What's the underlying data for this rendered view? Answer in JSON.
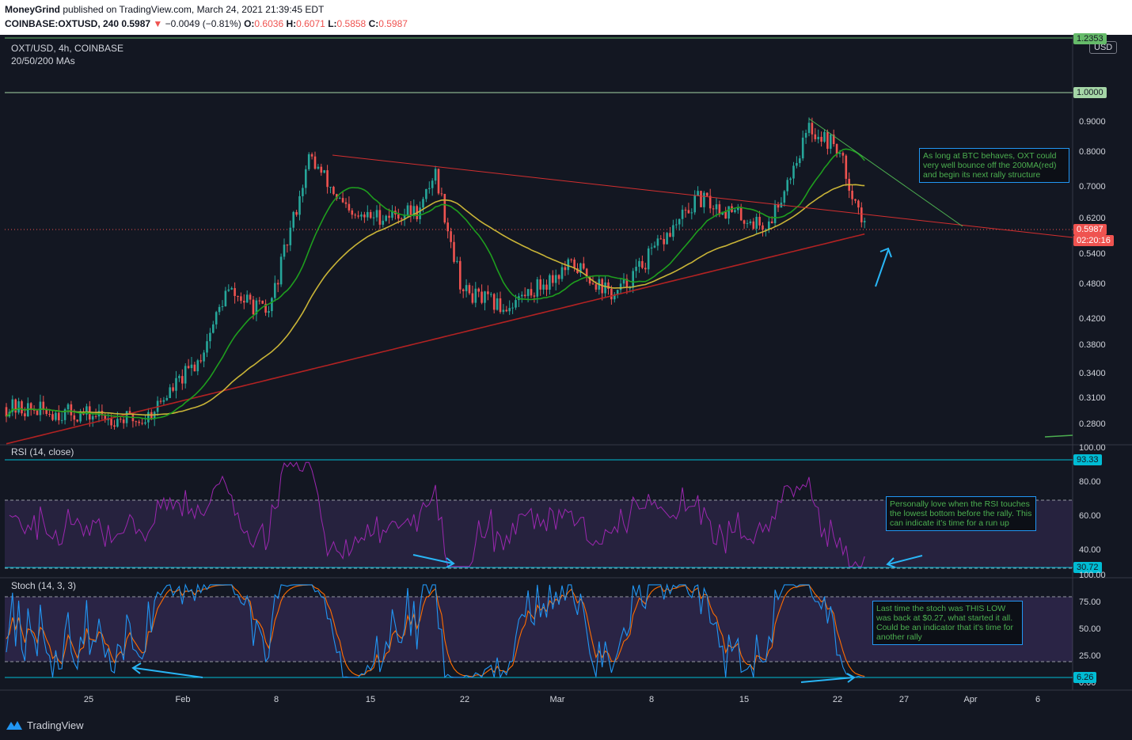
{
  "header": {
    "author": "MoneyGrind",
    "published": "published on TradingView.com, March 24, 2021 21:39:45 EDT",
    "symbol": "COINBASE:OXTUSD, 240",
    "last": "0.5987",
    "change": "−0.0049 (−0.81%)",
    "o_label": "O:",
    "o": "0.6036",
    "h_label": "H:",
    "h": "0.6071",
    "l_label": "L:",
    "l": "0.5858",
    "c_label": "C:",
    "c": "0.5987"
  },
  "main_panel": {
    "title": "OXT/USD, 4h, COINBASE",
    "subtitle": "20/50/200 MAs",
    "currency": "USD",
    "axis_ticks": [
      "0.9000",
      "0.8000",
      "0.7000",
      "0.6200",
      "0.5400",
      "0.4800",
      "0.4200",
      "0.3800",
      "0.3400",
      "0.3100",
      "0.2800"
    ],
    "level_top": "1.2353",
    "level_one": "1.0000",
    "last_price": "0.5987",
    "countdown": "02:20:16"
  },
  "rsi_panel": {
    "title": "RSI (14, close)",
    "axis_ticks": [
      "100.00",
      "80.00",
      "60.00",
      "40.00"
    ],
    "marker_high": "93.33",
    "marker_low": "30.72"
  },
  "stoch_panel": {
    "title": "Stoch (14, 3, 3)",
    "axis_ticks": [
      "100.00",
      "75.00",
      "50.00",
      "25.00",
      "0.00"
    ],
    "marker_low": "6.26"
  },
  "notes": {
    "main": "As long at BTC behaves, OXT could very well bounce off the 200MA(red) and begin its next rally structure",
    "rsi": "Personally love when the RSI touches the lowest bottom before the rally. This can indicate it's time for a run up",
    "stoch": "Last time the stoch was THIS LOW was back at $0.27, what started it all. Could be an indicator that it's time for another rally"
  },
  "dates": [
    "25",
    "Feb",
    "8",
    "15",
    "22",
    "Mar",
    "8",
    "15",
    "22",
    "27",
    "Apr",
    "6"
  ],
  "footer": {
    "brand": "TradingView"
  },
  "colors": {
    "up": "#26a69a",
    "down": "#ef5350",
    "ma20": "#1e9e1e",
    "ma50": "#c9b437",
    "ma200": "#b22222",
    "rsi": "#9c27b0",
    "stoch_k": "#2196f3",
    "stoch_d": "#ff6d00",
    "level": "#a5d6a7",
    "accent": "#00bcd4"
  },
  "chart_data": {
    "type": "candlestick",
    "x_range": [
      "2021-01-21",
      "2021-04-08"
    ],
    "y_scale": "log",
    "ylim": [
      0.265,
      1.25
    ],
    "key_points": [
      {
        "x": "2021-01-21",
        "y": 0.3
      },
      {
        "x": "2021-01-31",
        "y": 0.285
      },
      {
        "x": "2021-02-04",
        "y": 0.36
      },
      {
        "x": "2021-02-06",
        "y": 0.47
      },
      {
        "x": "2021-02-09",
        "y": 0.43
      },
      {
        "x": "2021-02-12",
        "y": 0.79
      },
      {
        "x": "2021-02-15",
        "y": 0.62
      },
      {
        "x": "2021-02-20",
        "y": 0.64
      },
      {
        "x": "2021-02-21",
        "y": 0.75
      },
      {
        "x": "2021-02-23",
        "y": 0.47
      },
      {
        "x": "2021-02-26",
        "y": 0.44
      },
      {
        "x": "2021-03-03",
        "y": 0.52
      },
      {
        "x": "2021-03-06",
        "y": 0.46
      },
      {
        "x": "2021-03-10",
        "y": 0.59
      },
      {
        "x": "2021-03-12",
        "y": 0.67
      },
      {
        "x": "2021-03-17",
        "y": 0.6
      },
      {
        "x": "2021-03-20",
        "y": 0.88
      },
      {
        "x": "2021-03-22",
        "y": 0.82
      },
      {
        "x": "2021-03-24",
        "y": 0.5987
      }
    ],
    "rsi_lines": {
      "upper": 70,
      "lower": 30,
      "high": 93.33,
      "low": 30.72
    },
    "stoch_lines": {
      "upper": 80,
      "lower": 20,
      "low": 6.26
    }
  }
}
